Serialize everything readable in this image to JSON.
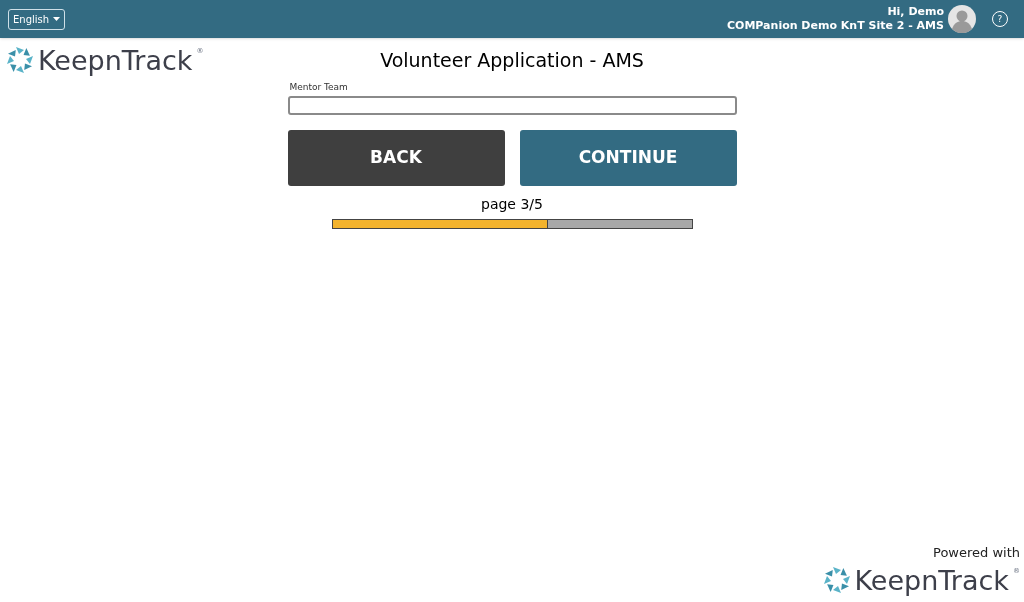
{
  "header": {
    "language": "English",
    "greeting": "Hi, Demo",
    "site": "COMPanion Demo KnT Site 2 - AMS",
    "help": "?"
  },
  "logo": {
    "name": "KeepnTrack",
    "mark": "®"
  },
  "title": "Volunteer Application - AMS",
  "form": {
    "fields": [
      {
        "label": "Mentor Team"
      }
    ]
  },
  "buttons": [
    {
      "label": "BACK",
      "kind": "secondary"
    },
    {
      "label": "CONTINUE",
      "kind": "primary"
    }
  ],
  "progress": {
    "label": "page 3/5",
    "level": 0.6
  },
  "footer": {
    "powered": "Powered with",
    "logo": {
      "name": "KeepnTrack",
      "mark": "®"
    }
  }
}
